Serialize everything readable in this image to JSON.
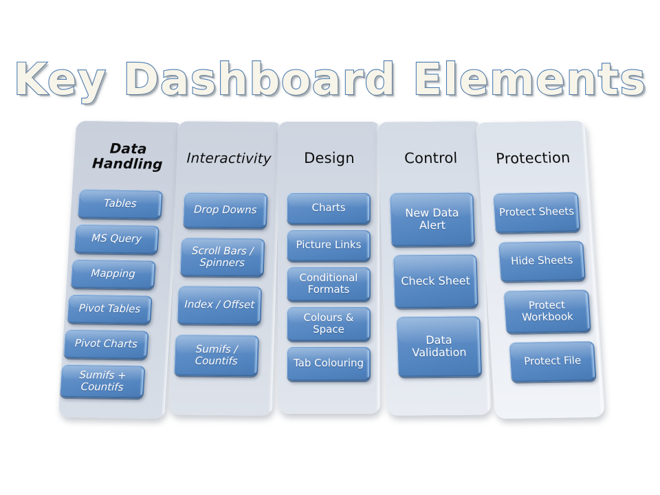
{
  "title": "Key Dashboard Elements",
  "background_color": "#ffffff",
  "colors": {
    "title_fill": "#f7f4e9",
    "title_outline": "#4a7ab0",
    "button_blue": "#5184bf",
    "button_blue_light": "#74a1d3",
    "button_blue_dark": "#4878b2",
    "button_text": "#ffffff",
    "panel_light": "#ced5e0",
    "header_text": "#0d0d0d"
  },
  "columns": [
    {
      "header": "Data Handling",
      "items": [
        "Tables",
        "MS Query",
        "Mapping",
        "Pivot Tables",
        "Pivot Charts",
        "Sumifs + Countifs"
      ]
    },
    {
      "header": "Interactivity",
      "items": [
        "Drop Downs",
        "Scroll Bars  / Spinners",
        "Index / Offset",
        "Sumifs / Countifs"
      ]
    },
    {
      "header": "Design",
      "items": [
        "Charts",
        "Picture Links",
        "Conditional Formats",
        "Colours & Space",
        "Tab Colouring"
      ]
    },
    {
      "header": "Control",
      "items": [
        "New Data Alert",
        "Check Sheet",
        "Data Validation"
      ]
    },
    {
      "header": "Protection",
      "items": [
        "Protect Sheets",
        "Hide Sheets",
        "Protect Workbook",
        "Protect File"
      ]
    }
  ]
}
